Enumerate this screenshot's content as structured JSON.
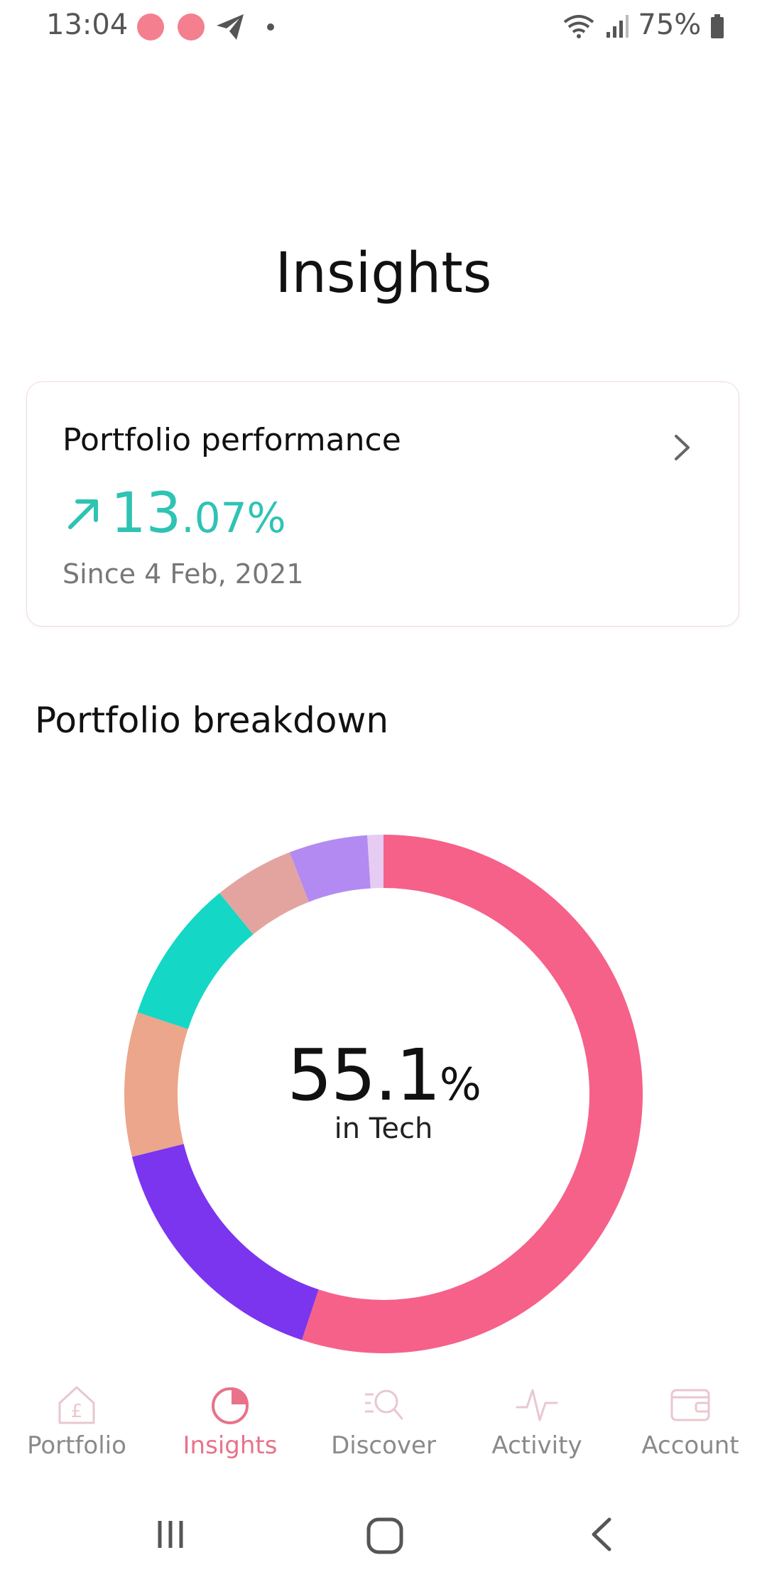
{
  "status_bar": {
    "time": "13:04",
    "battery": "75%",
    "icons": [
      "notification-dot-icon",
      "notification-dot-icon",
      "telegram-icon",
      "wifi-icon",
      "signal-icon",
      "battery-icon"
    ],
    "dot_color": "#f47f8f"
  },
  "header": {
    "title": "Insights"
  },
  "performance_card": {
    "title": "Portfolio performance",
    "value_main": "13",
    "value_decimal": ".07%",
    "since": "Since 4 Feb, 2021",
    "accent_color": "#2fc3b3"
  },
  "breakdown": {
    "title": "Portfolio breakdown",
    "center_value_main": "55.1",
    "center_value_unit": "%",
    "center_label": "in Tech"
  },
  "chart_data": {
    "type": "pie",
    "style": "donut",
    "slices": [
      {
        "percent": 55.1,
        "color": "#f66189",
        "label": "Tech"
      },
      {
        "percent": 16.0,
        "color": "#7b35ee"
      },
      {
        "percent": 9.0,
        "color": "#eba68b"
      },
      {
        "percent": 9.0,
        "color": "#14d7c6"
      },
      {
        "percent": 5.0,
        "color": "#e3a4a0"
      },
      {
        "percent": 4.9,
        "color": "#b38af1"
      },
      {
        "percent": 1.0,
        "color": "#e6cbf2"
      }
    ]
  },
  "bottom_nav": {
    "items": [
      {
        "label": "Portfolio",
        "icon": "pound-house-icon",
        "active": false
      },
      {
        "label": "Insights",
        "icon": "pie-chart-icon",
        "active": true
      },
      {
        "label": "Discover",
        "icon": "search-list-icon",
        "active": false
      },
      {
        "label": "Activity",
        "icon": "pulse-icon",
        "active": false
      },
      {
        "label": "Account",
        "icon": "wallet-icon",
        "active": false
      }
    ],
    "active_color": "#e8728a",
    "inactive_color": "#8a8a8a"
  },
  "system_nav": {
    "icons": [
      "recents-icon",
      "home-icon",
      "back-icon"
    ]
  }
}
